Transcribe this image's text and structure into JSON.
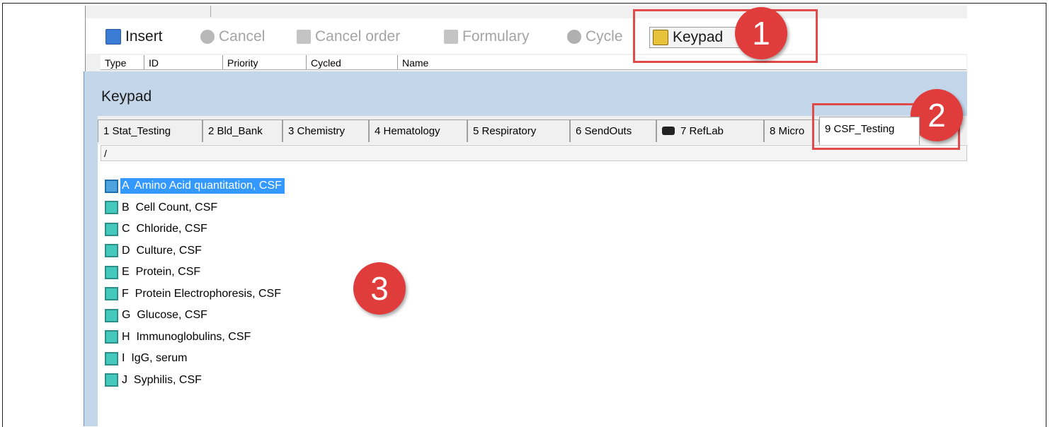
{
  "toolbar": {
    "insert": "Insert",
    "cancel": "Cancel",
    "cancel_order": "Cancel order",
    "formulary": "Formulary",
    "cycle": "Cycle",
    "keypad": "Keypad"
  },
  "columns": [
    "Type",
    "ID",
    "Priority",
    "Cycled",
    "Name"
  ],
  "keypad": {
    "title": "Keypad",
    "tabs": [
      "1 Stat_Testing",
      "2 Bld_Bank",
      "3 Chemistry",
      "4 Hematology",
      "5 Respiratory",
      "6 SendOuts",
      "7 RefLab",
      "8 Micro",
      "9 CSF_Testing"
    ],
    "active_tab": "9 CSF_Testing",
    "path": "/",
    "items": [
      "A  Amino Acid quantitation, CSF",
      "B  Cell Count, CSF",
      "C  Chloride, CSF",
      "D  Culture, CSF",
      "E  Protein, CSF",
      "F  Protein Electrophoresis, CSF",
      "G  Glucose, CSF",
      "H  Immunoglobulins, CSF",
      "I  IgG, serum",
      "J  Syphilis, CSF"
    ],
    "selected_index": 0
  },
  "annotations": [
    "1",
    "2",
    "3"
  ],
  "colors": {
    "annotation": "#e03c3c",
    "selection": "#3399ff",
    "item_icon": "#45c8be"
  }
}
